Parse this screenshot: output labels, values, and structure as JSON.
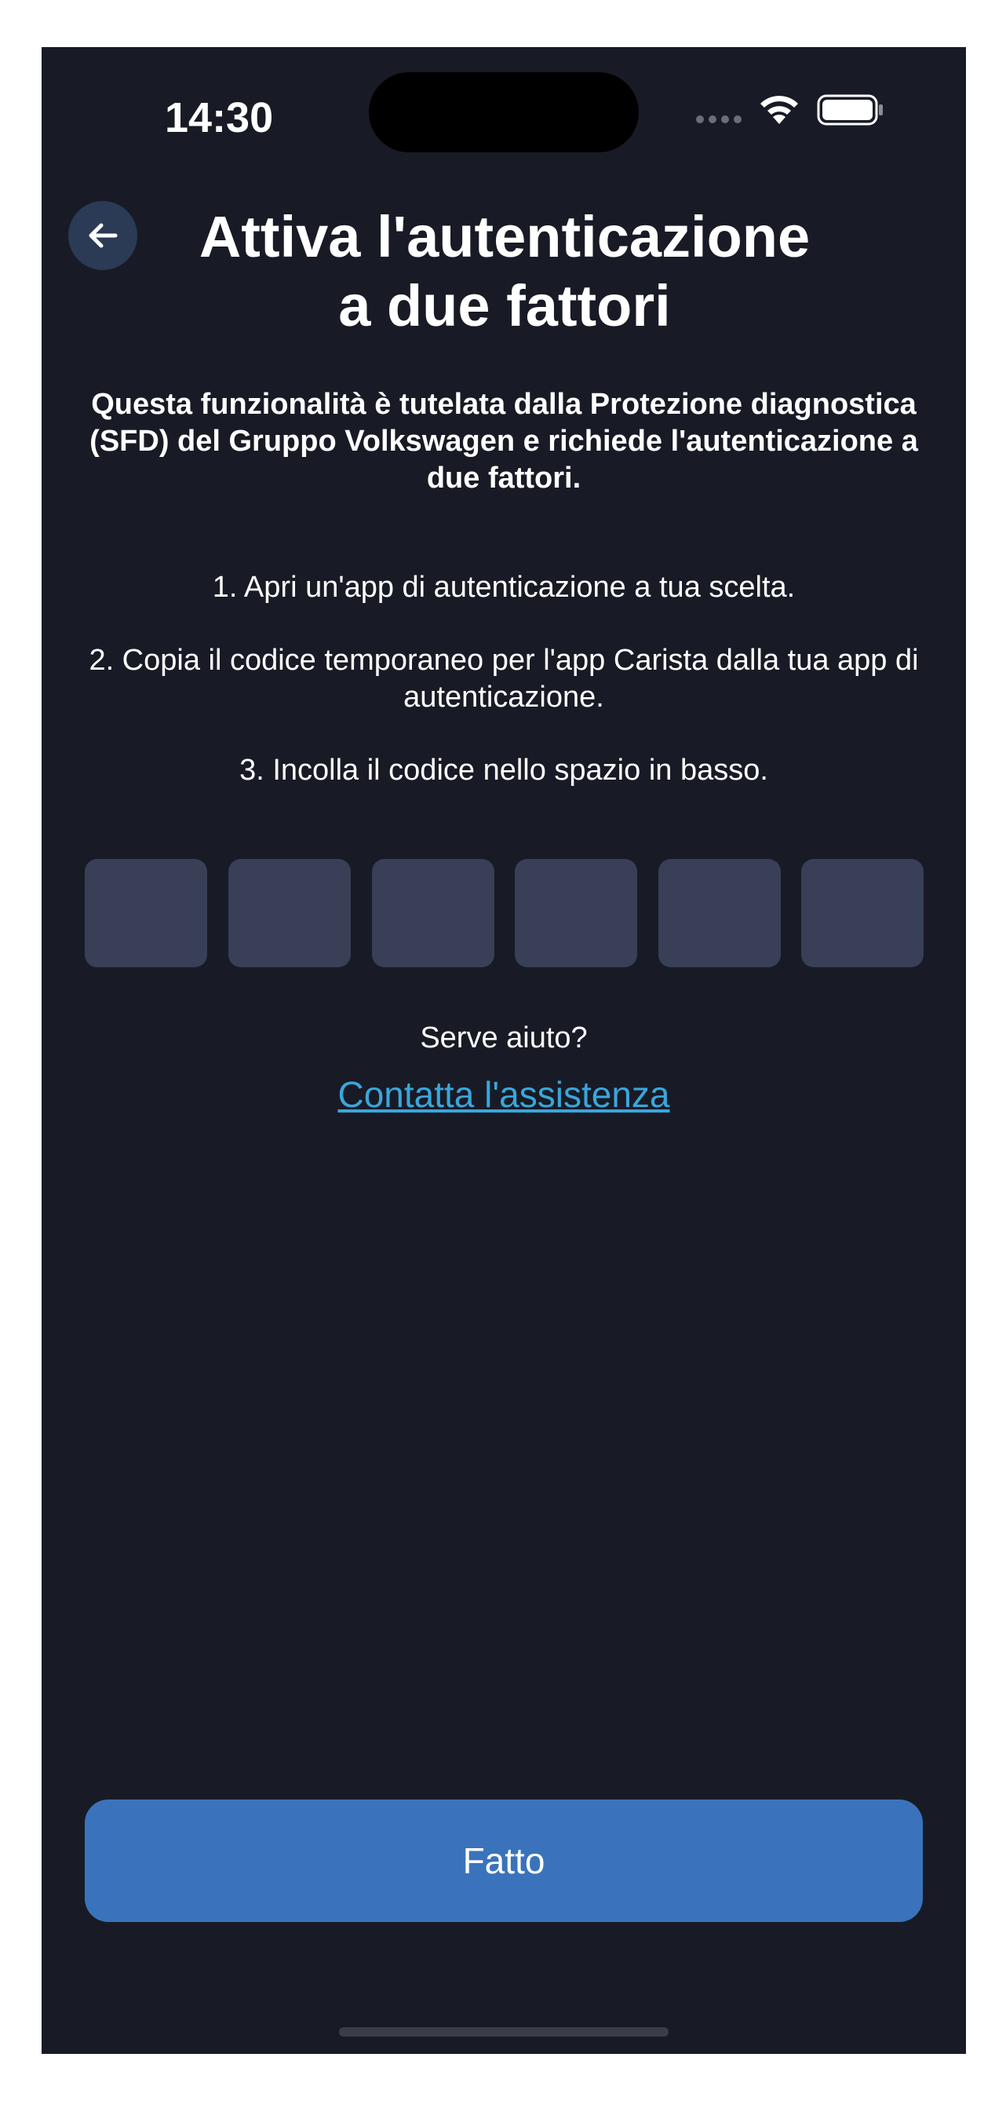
{
  "status_bar": {
    "time": "14:30"
  },
  "header": {
    "back_icon": "arrow-left-icon",
    "title_line1": "Attiva l'autenticazione",
    "title_line2": "a due fattori"
  },
  "intro": "Questa funzionalità è tutelata dalla Protezione diagnostica (SFD) del Gruppo Volkswagen e richiede l'autenticazione a due fattori.",
  "steps": [
    "1. Apri un'app di autenticazione a tua scelta.",
    "2. Copia il codice temporaneo per l'app Carista dalla tua app di autenticazione.",
    "3. Incolla il codice nello spazio in basso."
  ],
  "code_inputs": {
    "values": [
      "",
      "",
      "",
      "",
      "",
      ""
    ]
  },
  "help": {
    "question": "Serve aiuto?",
    "link_label": "Contatta l'assistenza"
  },
  "footer": {
    "done_label": "Fatto"
  },
  "colors": {
    "background": "#181b25",
    "input_box": "#383f57",
    "accent_button": "#3a73bb",
    "link": "#3aa6dc",
    "back_button": "#2b3a55"
  }
}
